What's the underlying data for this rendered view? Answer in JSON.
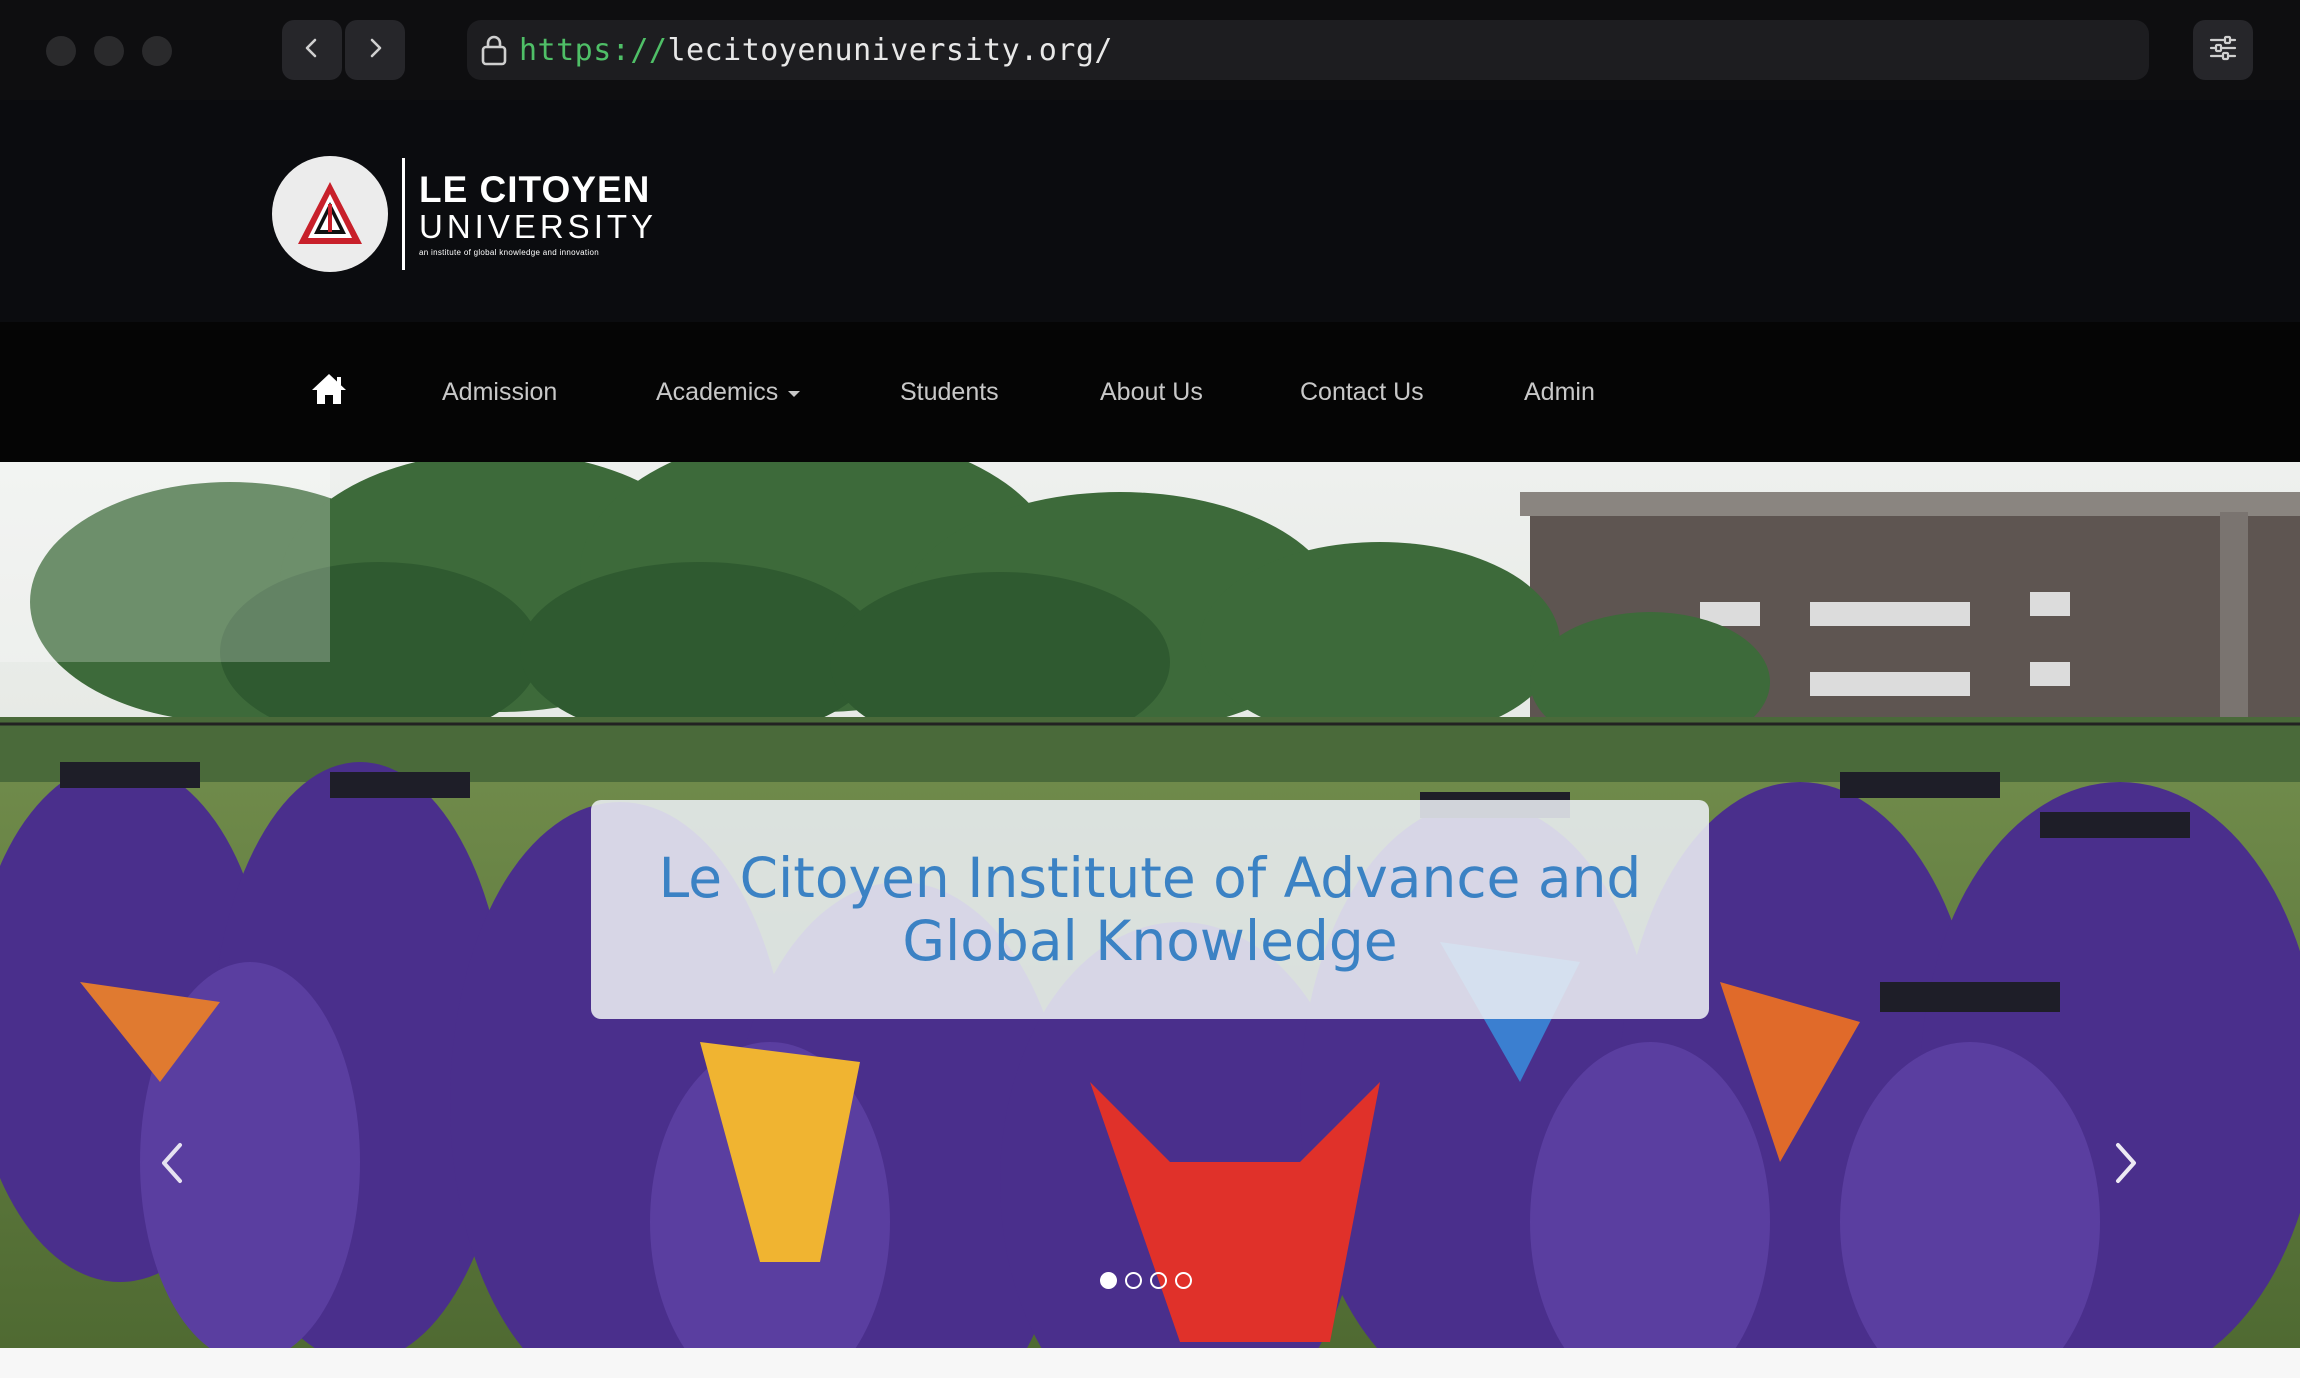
{
  "browser": {
    "url_scheme": "https://",
    "url_rest": "lecitoyenuniversity.org/",
    "icons": [
      "lock-icon",
      "back-arrow-icon",
      "forward-arrow-icon",
      "settings-sliders-icon"
    ]
  },
  "logo": {
    "line1": "LE CITOYEN",
    "line2": "UNIVERSITY",
    "tagline": "an institute of global knowledge and innovation"
  },
  "nav": {
    "home_icon": "home-icon",
    "items": [
      {
        "label": "Admission"
      },
      {
        "label": "Academics",
        "has_dropdown": true
      },
      {
        "label": "Students"
      },
      {
        "label": "About Us"
      },
      {
        "label": "Contact Us"
      },
      {
        "label": "Admin"
      }
    ]
  },
  "hero": {
    "caption": "Le Citoyen Institute of Advance and Global Knowledge",
    "slide_count": 4,
    "active_slide": 1
  },
  "colors": {
    "header_bg": "#0b0c0f",
    "nav_bg": "#050505",
    "caption_text": "#3b82c4",
    "url_scheme": "#4fbf67"
  }
}
